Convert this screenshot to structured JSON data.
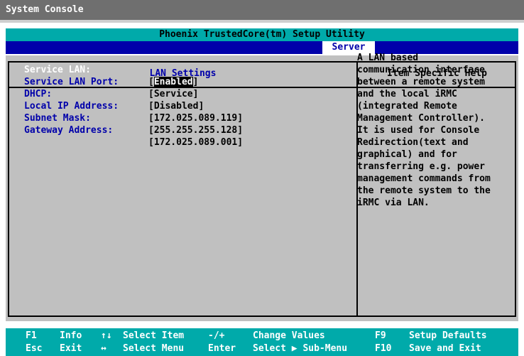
{
  "window": {
    "title": "System Console"
  },
  "bios": {
    "header": "Phoenix TrustedCore(tm) Setup Utility",
    "active_menu": "Server",
    "panel_title": "LAN Settings",
    "help_title": "Item Specific Help",
    "settings": [
      {
        "label": "Service LAN:",
        "value_open": "[",
        "value": "Enabled",
        "value_close": "]"
      },
      {
        "label": "Service LAN Port:",
        "value": "[Service]"
      },
      {
        "label": "DHCP:",
        "value": "[Disabled]"
      },
      {
        "label": "Local IP Address:",
        "value": "[172.025.089.119]"
      },
      {
        "label": "Subnet Mask:",
        "value": "[255.255.255.128]"
      },
      {
        "label": "Gateway Address:",
        "value": "[172.025.089.001]"
      }
    ],
    "help_lines": [
      "A LAN based",
      "communication interface",
      "between a remote system",
      "and the local iRMC",
      "(integrated Remote",
      "Management Controller).",
      "It is used for Console",
      "Redirection(text and",
      "graphical) and for",
      "transferring e.g. power",
      "management commands from",
      "the remote system to the",
      "iRMC via LAN."
    ],
    "footer": {
      "row1": [
        {
          "key": "F1",
          "desc": "Info"
        },
        {
          "key": "↑↓",
          "desc": "Select Item"
        },
        {
          "key": "-/+",
          "desc": "Change Values"
        },
        {
          "key": "F9",
          "desc": "Setup Defaults"
        }
      ],
      "row2": [
        {
          "key": "Esc",
          "desc": "Exit"
        },
        {
          "key": "↔",
          "desc": "Select Menu"
        },
        {
          "key": "Enter",
          "desc": "Select ▶ Sub-Menu"
        },
        {
          "key": "F10",
          "desc": "Save and Exit"
        }
      ]
    }
  }
}
